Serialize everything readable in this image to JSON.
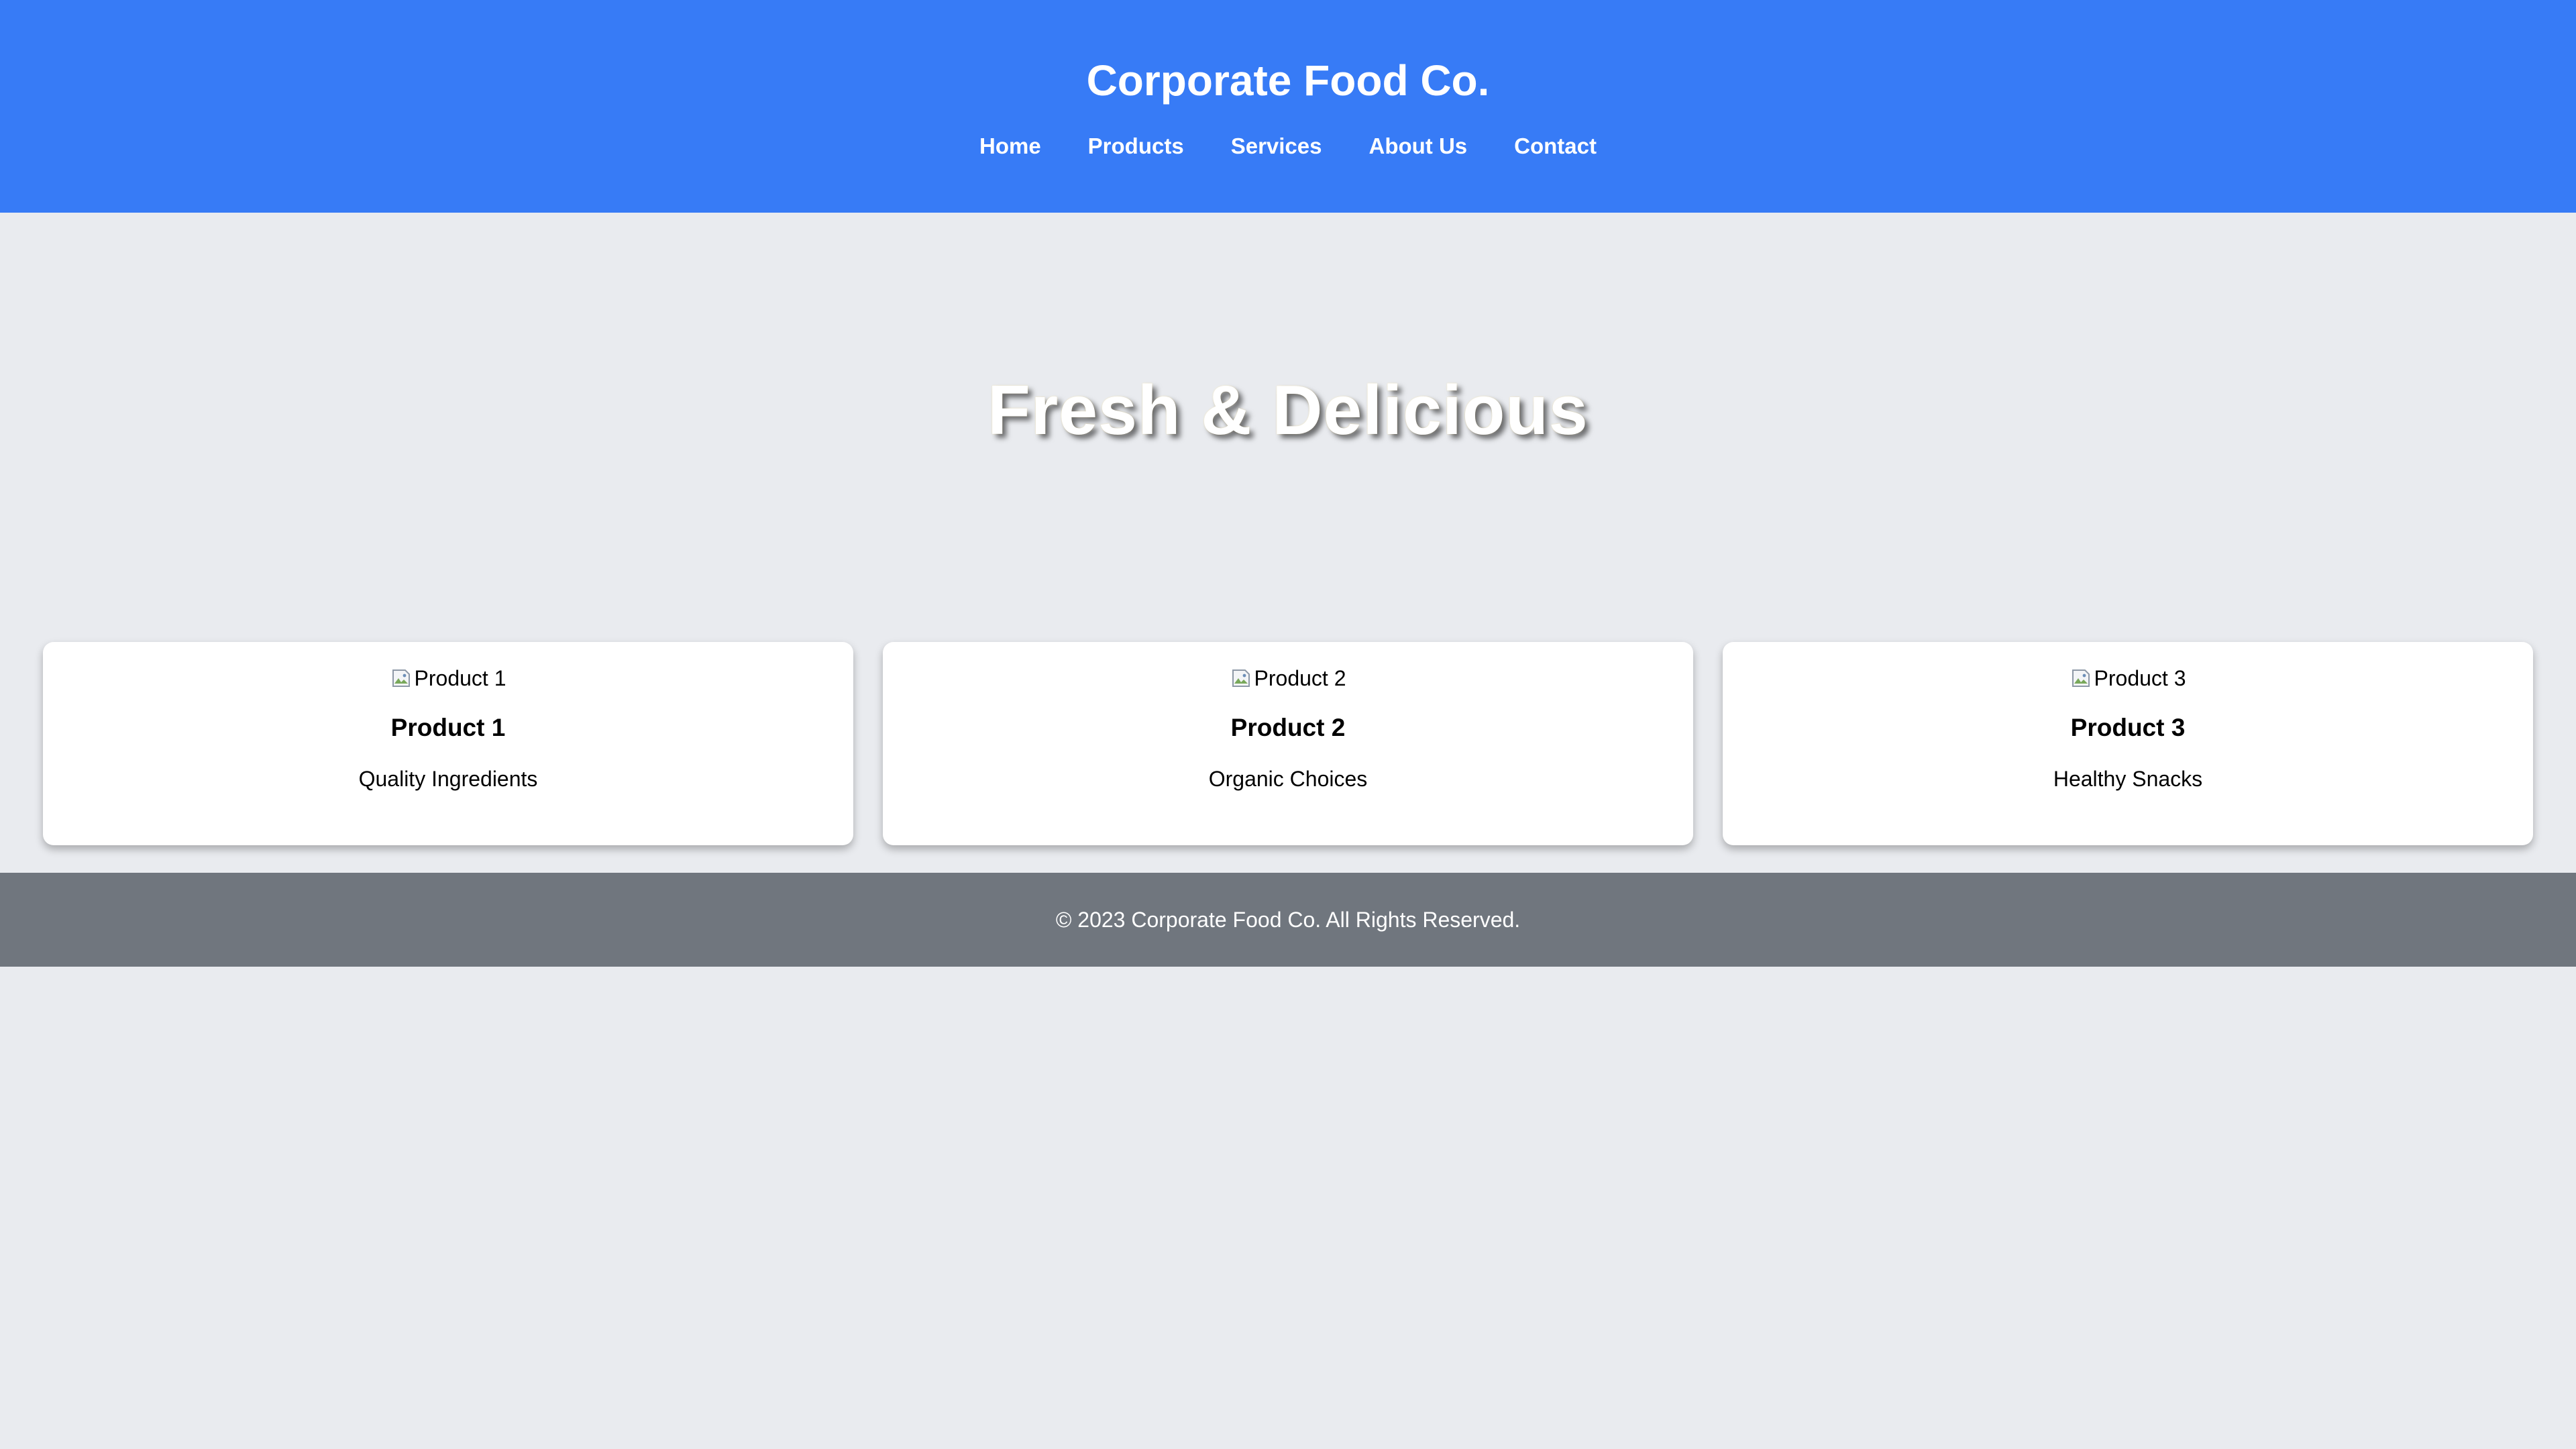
{
  "header": {
    "title": "Corporate Food Co.",
    "background_color": "#377bf6",
    "nav": [
      {
        "label": "Home"
      },
      {
        "label": "Products"
      },
      {
        "label": "Services"
      },
      {
        "label": "About Us"
      },
      {
        "label": "Contact"
      }
    ]
  },
  "hero": {
    "title": "Fresh & Delicious"
  },
  "products": [
    {
      "image_alt": "Product 1",
      "name": "Product 1",
      "description": "Quality Ingredients"
    },
    {
      "image_alt": "Product 2",
      "name": "Product 2",
      "description": "Organic Choices"
    },
    {
      "image_alt": "Product 3",
      "name": "Product 3",
      "description": "Healthy Snacks"
    }
  ],
  "footer": {
    "text": "© 2023 Corporate Food Co. All Rights Reserved.",
    "background_color": "#70767e"
  },
  "page": {
    "background_color": "#e9ebef"
  }
}
